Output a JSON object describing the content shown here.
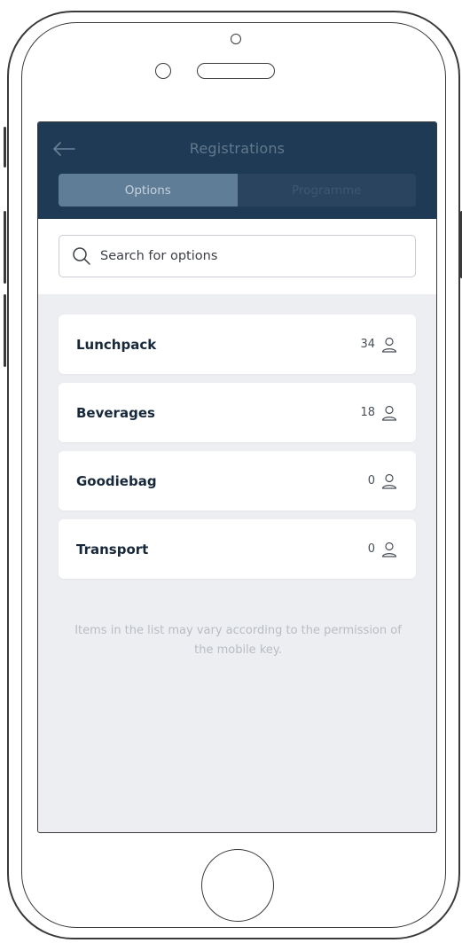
{
  "header": {
    "title": "Registrations",
    "tabs": [
      {
        "label": "Options",
        "active": true
      },
      {
        "label": "Programme",
        "active": false
      }
    ]
  },
  "search": {
    "placeholder": "Search for options",
    "value": ""
  },
  "options": [
    {
      "name": "Lunchpack",
      "count": "34"
    },
    {
      "name": "Beverages",
      "count": "18"
    },
    {
      "name": "Goodiebag",
      "count": "0"
    },
    {
      "name": "Transport",
      "count": "0"
    }
  ],
  "footnote": "Items in the list may vary according to the permission of the mobile key.",
  "icons": {
    "back": "arrow-left-icon",
    "search": "search-icon",
    "count": "user-icon"
  },
  "colors": {
    "header_bg": "#1f3a55",
    "active_tab": "#5f7d97",
    "background": "#edeef1",
    "card_text": "#16283a"
  }
}
